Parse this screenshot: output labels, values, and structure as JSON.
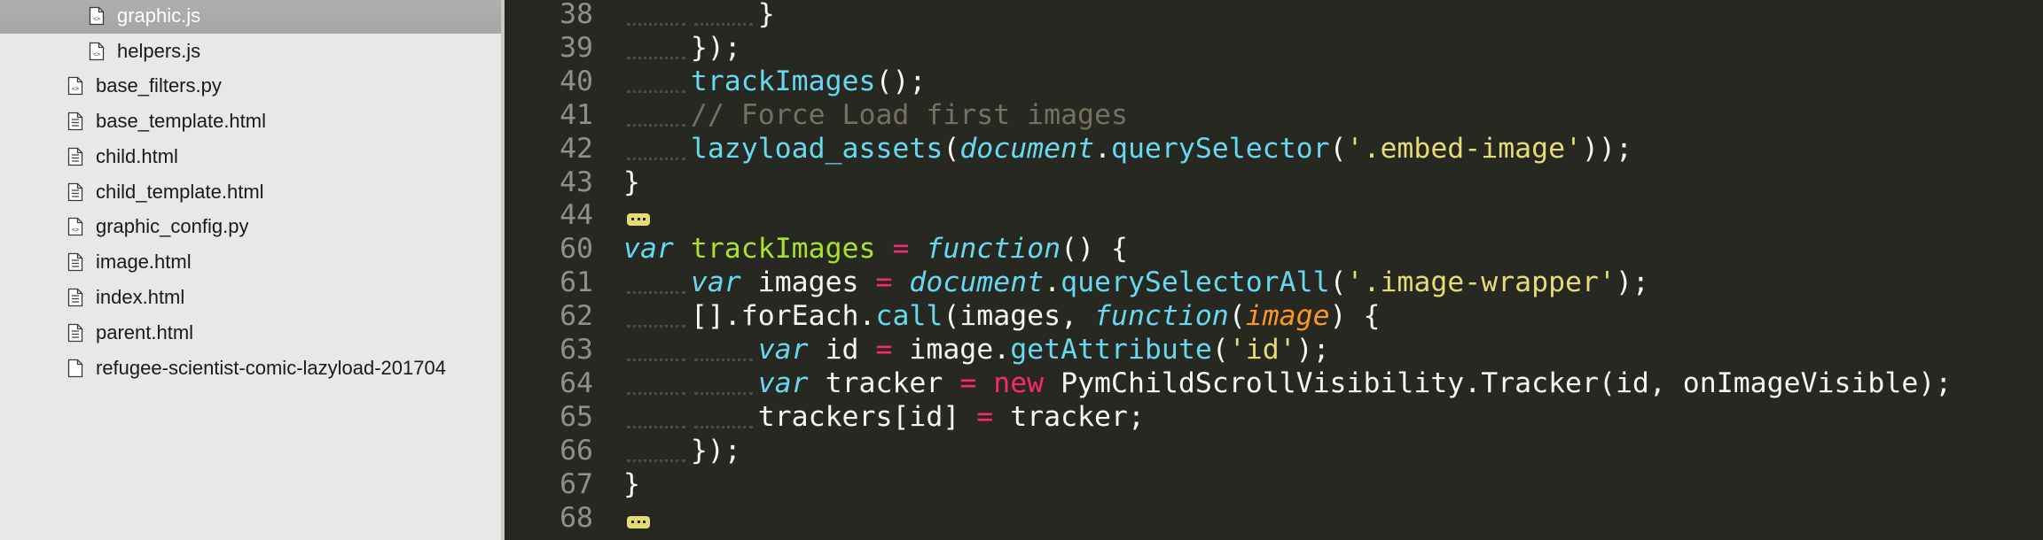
{
  "sidebar": {
    "files": [
      {
        "name": "graphic.js",
        "type": "js",
        "selected": true
      },
      {
        "name": "helpers.js",
        "type": "js",
        "selected": false
      },
      {
        "name": "base_filters.py",
        "type": "py",
        "selected": false
      },
      {
        "name": "base_template.html",
        "type": "html",
        "selected": false
      },
      {
        "name": "child.html",
        "type": "html",
        "selected": false
      },
      {
        "name": "child_template.html",
        "type": "html",
        "selected": false
      },
      {
        "name": "graphic_config.py",
        "type": "py",
        "selected": false
      },
      {
        "name": "image.html",
        "type": "html",
        "selected": false
      },
      {
        "name": "index.html",
        "type": "html",
        "selected": false
      },
      {
        "name": "parent.html",
        "type": "html",
        "selected": false
      },
      {
        "name": "refugee-scientist-comic-lazyload-201704",
        "type": "file",
        "selected": false
      }
    ]
  },
  "editor": {
    "colors": {
      "background": "#272822",
      "keyword": "#66d9ef",
      "function_name": "#a6e22e",
      "string": "#e6db74",
      "comment": "#75715e",
      "operator": "#f92672",
      "parameter": "#fd971f",
      "text": "#f8f8f2",
      "line_number": "#8f908a"
    },
    "lines": [
      {
        "number": "38",
        "indent": 2,
        "tokens": [
          {
            "t": "}",
            "c": "plain"
          }
        ]
      },
      {
        "number": "39",
        "indent": 1,
        "tokens": [
          {
            "t": "});",
            "c": "plain"
          }
        ]
      },
      {
        "number": "40",
        "indent": 1,
        "tokens": [
          {
            "t": "trackImages",
            "c": "call"
          },
          {
            "t": "();",
            "c": "plain"
          }
        ]
      },
      {
        "number": "41",
        "indent": 1,
        "tokens": [
          {
            "t": "// Force Load first images",
            "c": "cmt"
          }
        ]
      },
      {
        "number": "42",
        "indent": 1,
        "tokens": [
          {
            "t": "lazyload_assets",
            "c": "call"
          },
          {
            "t": "(",
            "c": "plain"
          },
          {
            "t": "document",
            "c": "kw"
          },
          {
            "t": ".",
            "c": "plain"
          },
          {
            "t": "querySelector",
            "c": "call"
          },
          {
            "t": "(",
            "c": "plain"
          },
          {
            "t": "'.embed-image'",
            "c": "str"
          },
          {
            "t": "));",
            "c": "plain"
          }
        ]
      },
      {
        "number": "43",
        "indent": 0,
        "tokens": [
          {
            "t": "}",
            "c": "plain"
          }
        ]
      },
      {
        "number": "44",
        "indent": 0,
        "fold": true,
        "tokens": []
      },
      {
        "number": "60",
        "indent": 0,
        "tokens": [
          {
            "t": "var",
            "c": "kw"
          },
          {
            "t": " ",
            "c": "plain"
          },
          {
            "t": "trackImages",
            "c": "fn"
          },
          {
            "t": " ",
            "c": "plain"
          },
          {
            "t": "=",
            "c": "op"
          },
          {
            "t": " ",
            "c": "plain"
          },
          {
            "t": "function",
            "c": "kw"
          },
          {
            "t": "() {",
            "c": "plain"
          }
        ]
      },
      {
        "number": "61",
        "indent": 1,
        "tokens": [
          {
            "t": "var",
            "c": "kw"
          },
          {
            "t": " images ",
            "c": "plain"
          },
          {
            "t": "=",
            "c": "op"
          },
          {
            "t": " ",
            "c": "plain"
          },
          {
            "t": "document",
            "c": "kw"
          },
          {
            "t": ".",
            "c": "plain"
          },
          {
            "t": "querySelectorAll",
            "c": "call"
          },
          {
            "t": "(",
            "c": "plain"
          },
          {
            "t": "'.image-wrapper'",
            "c": "str"
          },
          {
            "t": ");",
            "c": "plain"
          }
        ]
      },
      {
        "number": "62",
        "indent": 1,
        "tokens": [
          {
            "t": "[].forEach.",
            "c": "plain"
          },
          {
            "t": "call",
            "c": "call"
          },
          {
            "t": "(images, ",
            "c": "plain"
          },
          {
            "t": "function",
            "c": "kw"
          },
          {
            "t": "(",
            "c": "plain"
          },
          {
            "t": "image",
            "c": "param"
          },
          {
            "t": ") {",
            "c": "plain"
          }
        ]
      },
      {
        "number": "63",
        "indent": 2,
        "tokens": [
          {
            "t": "var",
            "c": "kw"
          },
          {
            "t": " id ",
            "c": "plain"
          },
          {
            "t": "=",
            "c": "op"
          },
          {
            "t": " image.",
            "c": "plain"
          },
          {
            "t": "getAttribute",
            "c": "call"
          },
          {
            "t": "(",
            "c": "plain"
          },
          {
            "t": "'id'",
            "c": "str"
          },
          {
            "t": ");",
            "c": "plain"
          }
        ]
      },
      {
        "number": "64",
        "indent": 2,
        "tokens": [
          {
            "t": "var",
            "c": "kw"
          },
          {
            "t": " tracker ",
            "c": "plain"
          },
          {
            "t": "=",
            "c": "op"
          },
          {
            "t": " ",
            "c": "plain"
          },
          {
            "t": "new",
            "c": "op"
          },
          {
            "t": " PymChildScrollVisibility.Tracker(id, onImageVisible);",
            "c": "plain"
          }
        ]
      },
      {
        "number": "65",
        "indent": 2,
        "tokens": [
          {
            "t": "trackers[id] ",
            "c": "plain"
          },
          {
            "t": "=",
            "c": "op"
          },
          {
            "t": " tracker;",
            "c": "plain"
          }
        ]
      },
      {
        "number": "66",
        "indent": 1,
        "tokens": [
          {
            "t": "});",
            "c": "plain"
          }
        ]
      },
      {
        "number": "67",
        "indent": 0,
        "tokens": [
          {
            "t": "}",
            "c": "plain"
          }
        ]
      },
      {
        "number": "68",
        "indent": 0,
        "fold": true,
        "tokens": []
      }
    ]
  }
}
